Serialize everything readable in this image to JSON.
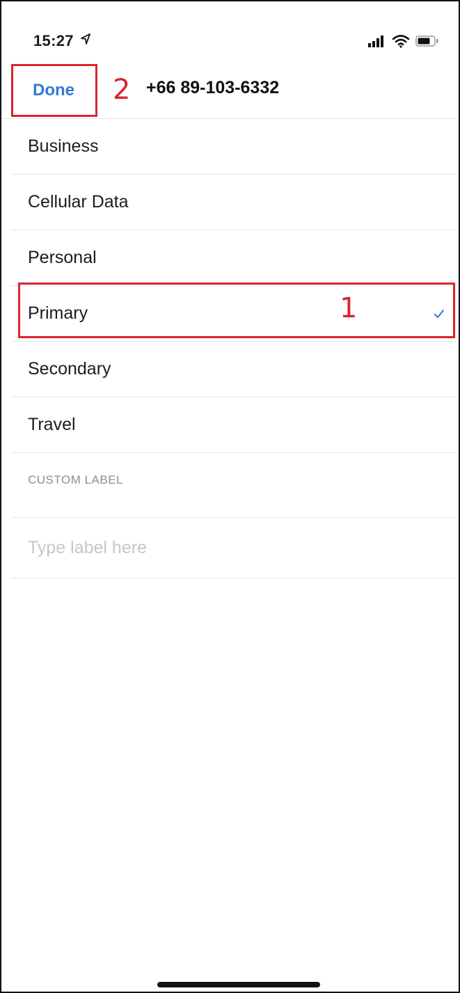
{
  "status_bar": {
    "time": "15:27",
    "icons": [
      "location-arrow-icon",
      "signal-icon",
      "wifi-icon",
      "battery-icon"
    ]
  },
  "nav": {
    "done_label": "Done",
    "title": "+66 89-103-6332",
    "accent_color": "#2f7ad6"
  },
  "labels": [
    {
      "label": "Business",
      "selected": false
    },
    {
      "label": "Cellular Data",
      "selected": false
    },
    {
      "label": "Personal",
      "selected": false
    },
    {
      "label": "Primary",
      "selected": true
    },
    {
      "label": "Secondary",
      "selected": false
    },
    {
      "label": "Travel",
      "selected": false
    }
  ],
  "custom_label": {
    "header": "CUSTOM LABEL",
    "placeholder": "Type label here",
    "value": ""
  },
  "annotations": {
    "primary_marker": "1",
    "done_marker": "2",
    "color": "#d9262e"
  }
}
